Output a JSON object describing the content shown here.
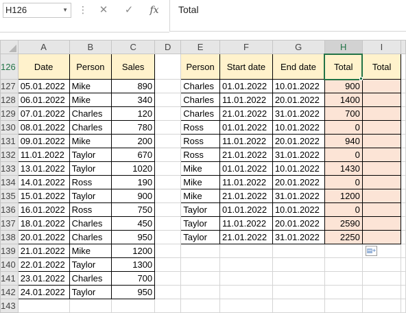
{
  "formula_bar": {
    "name_box": "H126",
    "cancel_icon": "✕",
    "enter_icon": "✓",
    "fx_label": "fx",
    "content": "Total"
  },
  "columns": [
    "A",
    "B",
    "C",
    "D",
    "E",
    "F",
    "G",
    "H",
    "I"
  ],
  "selected_column": "H",
  "selected_cell": "H126",
  "left_table": {
    "headers": [
      "Date",
      "Person",
      "Sales"
    ],
    "rows": [
      [
        "05.01.2022",
        "Mike",
        "890"
      ],
      [
        "06.01.2022",
        "Mike",
        "340"
      ],
      [
        "07.01.2022",
        "Charles",
        "120"
      ],
      [
        "08.01.2022",
        "Charles",
        "780"
      ],
      [
        "09.01.2022",
        "Mike",
        "200"
      ],
      [
        "11.01.2022",
        "Taylor",
        "670"
      ],
      [
        "13.01.2022",
        "Taylor",
        "1020"
      ],
      [
        "14.01.2022",
        "Ross",
        "190"
      ],
      [
        "15.01.2022",
        "Taylor",
        "900"
      ],
      [
        "16.01.2022",
        "Ross",
        "750"
      ],
      [
        "18.01.2022",
        "Charles",
        "450"
      ],
      [
        "20.01.2022",
        "Charles",
        "950"
      ],
      [
        "21.01.2022",
        "Mike",
        "1200"
      ],
      [
        "22.01.2022",
        "Taylor",
        "1300"
      ],
      [
        "23.01.2022",
        "Charles",
        "700"
      ],
      [
        "24.01.2022",
        "Taylor",
        "950"
      ]
    ]
  },
  "right_table": {
    "headers": [
      "Person",
      "Start date",
      "End date",
      "Total",
      "Total"
    ],
    "rows": [
      [
        "Charles",
        "01.01.2022",
        "10.01.2022",
        "900",
        ""
      ],
      [
        "Charles",
        "11.01.2022",
        "20.01.2022",
        "1400",
        ""
      ],
      [
        "Charles",
        "21.01.2022",
        "31.01.2022",
        "700",
        ""
      ],
      [
        "Ross",
        "01.01.2022",
        "10.01.2022",
        "0",
        ""
      ],
      [
        "Ross",
        "11.01.2022",
        "20.01.2022",
        "940",
        ""
      ],
      [
        "Ross",
        "21.01.2022",
        "31.01.2022",
        "0",
        ""
      ],
      [
        "Mike",
        "01.01.2022",
        "10.01.2022",
        "1430",
        ""
      ],
      [
        "Mike",
        "11.01.2022",
        "20.01.2022",
        "0",
        ""
      ],
      [
        "Mike",
        "21.01.2022",
        "31.01.2022",
        "1200",
        ""
      ],
      [
        "Taylor",
        "01.01.2022",
        "10.01.2022",
        "0",
        ""
      ],
      [
        "Taylor",
        "11.01.2022",
        "20.01.2022",
        "2590",
        ""
      ],
      [
        "Taylor",
        "21.01.2022",
        "31.01.2022",
        "2250",
        ""
      ]
    ]
  },
  "row_numbers": [
    "126",
    "127",
    "128",
    "129",
    "130",
    "131",
    "132",
    "133",
    "134",
    "135",
    "136",
    "137",
    "138",
    "139",
    "140",
    "141",
    "142",
    "143"
  ],
  "colors": {
    "header_fill": "#fff2cc",
    "result_fill": "#fce4d6",
    "selection": "#217346"
  }
}
